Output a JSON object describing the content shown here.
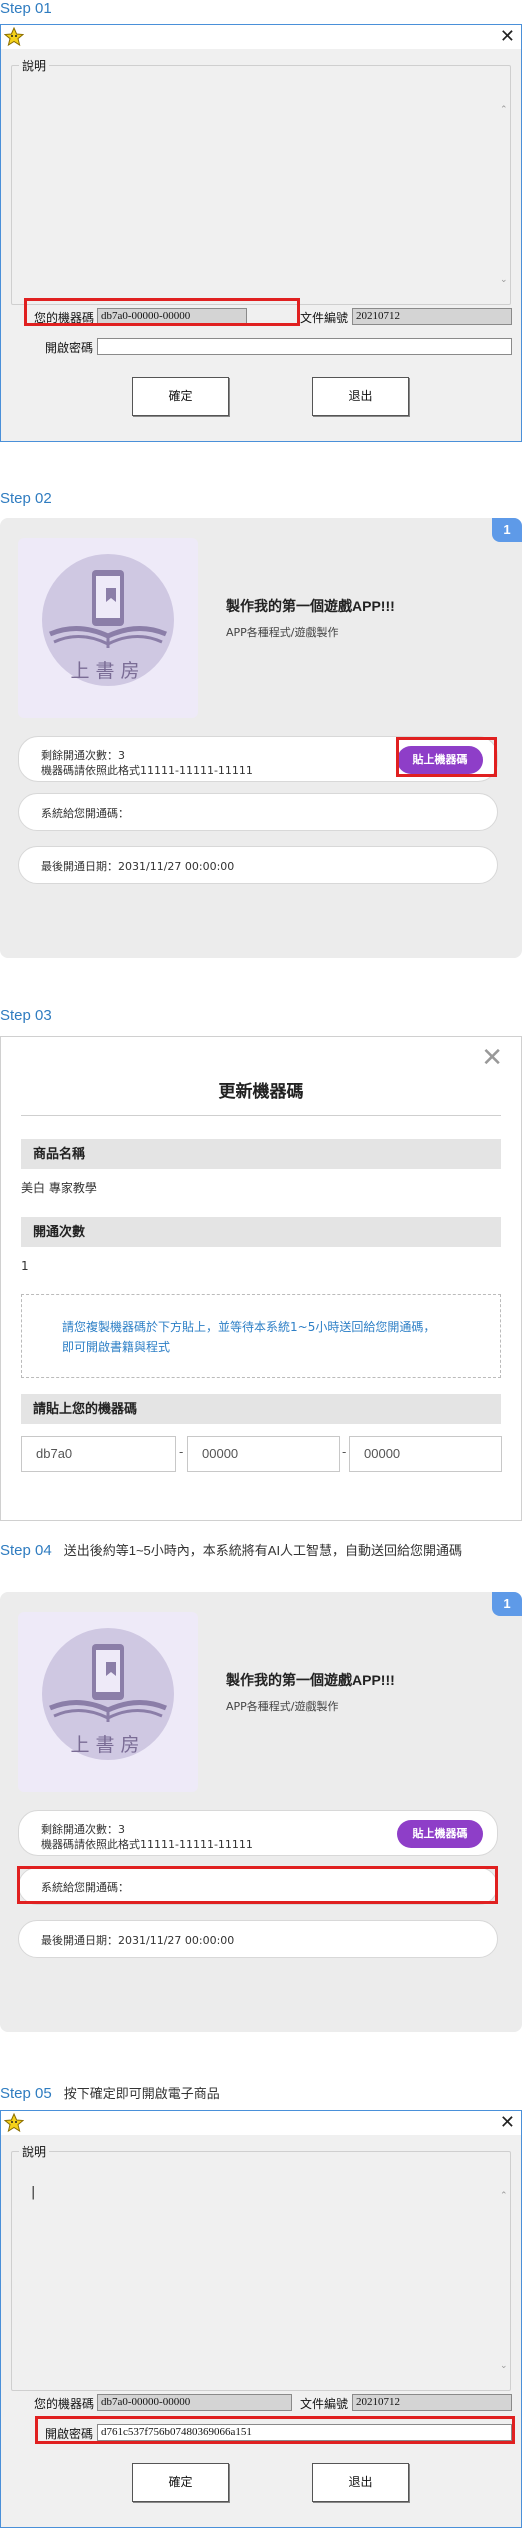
{
  "colors": {
    "accent_blue": "#2f7cc0",
    "highlight_red": "#e02020",
    "paste_button": "#8e3ec8",
    "badge": "#5e9ae8",
    "notice_text": "#2d7fc6"
  },
  "steps": [
    {
      "label": "Step 01",
      "desc": ""
    },
    {
      "label": "Step 02",
      "desc": ""
    },
    {
      "label": "Step 03",
      "desc": ""
    },
    {
      "label": "Step 04",
      "desc": "送出後約等1~5小時內，本系統將有AI人工智慧，自動送回給您開通碼"
    },
    {
      "label": "Step 05",
      "desc": "按下確定即可開啟電子商品"
    }
  ],
  "win1": {
    "icon": "star-app-icon",
    "group_label": "說明",
    "machine_label": "您的機器碼",
    "machine_value": "db7a0-00000-00000",
    "doc_label": "文件編號",
    "doc_value": "20210712",
    "password_label": "開啟密碼",
    "password_value": "",
    "ok_label": "確定",
    "exit_label": "退出"
  },
  "card1": {
    "badge": "1",
    "cover_logo_text": "上書房",
    "title": "製作我的第一個遊戲APP!!!",
    "subtitle": "APP各種程式/遊戲製作",
    "remaining_label": "剩餘開通次數：3",
    "format_hint": "機器碼請依照此格式11111-11111-11111",
    "paste_button": "貼上機器碼",
    "activation_label": "系統給您開通碼：",
    "last_date_label": "最後開通日期：2031/11/27 00:00:00"
  },
  "dialog3": {
    "title": "更新機器碼",
    "product_heading": "商品名稱",
    "product_name": "美白 專家教學",
    "count_heading": "開通次數",
    "count_value": "1",
    "notice_line1": "請您複製機器碼於下方貼上，並等待本系統1~5小時送回給您開通碼，",
    "notice_line2": "即可開啟書籍與程式",
    "paste_heading": "請貼上您的機器碼",
    "code_part1": "db7a0",
    "code_part2": "00000",
    "code_part3": "00000",
    "separator": "-"
  },
  "card2": {
    "badge": "1",
    "cover_logo_text": "上書房",
    "title": "製作我的第一個遊戲APP!!!",
    "subtitle": "APP各種程式/遊戲製作",
    "remaining_label": "剩餘開通次數：3",
    "format_hint": "機器碼請依照此格式11111-11111-11111",
    "paste_button": "貼上機器碼",
    "activation_label": "系統給您開通碼：",
    "last_date_label": "最後開通日期：2031/11/27 00:00:00"
  },
  "win2": {
    "group_label": "說明",
    "text_cursor": "|",
    "machine_label": "您的機器碼",
    "machine_value": "db7a0-00000-00000",
    "doc_label": "文件編號",
    "doc_value": "20210712",
    "password_label": "開啟密碼",
    "password_value": "d761c537f756b07480369066a151",
    "ok_label": "確定",
    "exit_label": "退出"
  }
}
